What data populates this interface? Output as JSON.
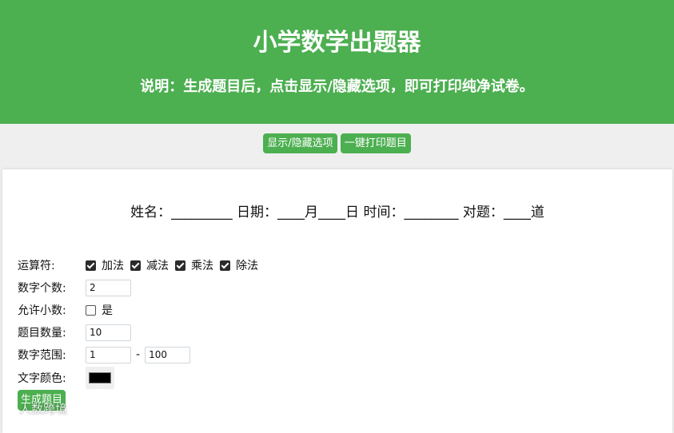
{
  "header": {
    "title": "小学数学出题器",
    "subtitle": "说明：生成题目后，点击显示/隐藏选项，即可打印纯净试卷。"
  },
  "toolbar": {
    "toggle_label": "显示/隐藏选项",
    "print_label": "一键打印题目"
  },
  "info_line": "姓名：_________ 日期：____月____日 时间：________ 对题：____道",
  "options": {
    "operators_label": "运算符:",
    "operators": [
      {
        "label": "加法",
        "checked": true
      },
      {
        "label": "减法",
        "checked": true
      },
      {
        "label": "乘法",
        "checked": true
      },
      {
        "label": "除法",
        "checked": true
      }
    ],
    "number_count_label": "数字个数:",
    "number_count_value": "2",
    "allow_decimal_label": "允许小数:",
    "allow_decimal_option": "是",
    "allow_decimal_checked": false,
    "question_count_label": "题目数量:",
    "question_count_value": "10",
    "range_label": "数字范围:",
    "range_min": "1",
    "range_separator": "-",
    "range_max": "100",
    "text_color_label": "文字颜色:",
    "text_color_value": "#000000"
  },
  "generate_label": "生成题目",
  "watermark_text": "人数跨境",
  "colors": {
    "accent": "#4caf50",
    "background": "#efefef",
    "panel": "#ffffff"
  }
}
